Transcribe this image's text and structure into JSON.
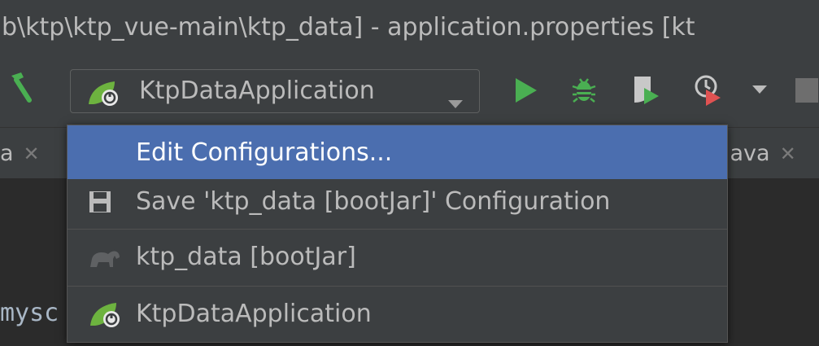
{
  "window": {
    "title": "b\\ktp\\ktp_vue-main\\ktp_data] - application.properties [kt"
  },
  "toolbar": {
    "run_configuration": "KtpDataApplication",
    "icons": [
      "hammer-icon",
      "spring-boot-icon",
      "run-icon",
      "debug-icon",
      "coverage-icon",
      "profile-icon",
      "stop-icon"
    ],
    "colors": {
      "run": "#4aaf52",
      "debug": "#4aaf52",
      "profile_badge": "#e05252"
    }
  },
  "tabs": {
    "left_fragment": "a",
    "right_fragment": "java"
  },
  "editor": {
    "code_fragment": "mysc"
  },
  "menu": {
    "items": [
      {
        "label": "Edit Configurations...",
        "icon": null,
        "selected": true
      },
      {
        "label": "Save 'ktp_data [bootJar]' Configuration",
        "icon": "save-icon",
        "selected": false
      },
      {
        "label": "ktp_data [bootJar]",
        "icon": "gradle-elephant-icon",
        "selected": false
      },
      {
        "label": "KtpDataApplication",
        "icon": "spring-boot-icon",
        "selected": false
      }
    ],
    "selection_color": "#4b6eaf"
  }
}
